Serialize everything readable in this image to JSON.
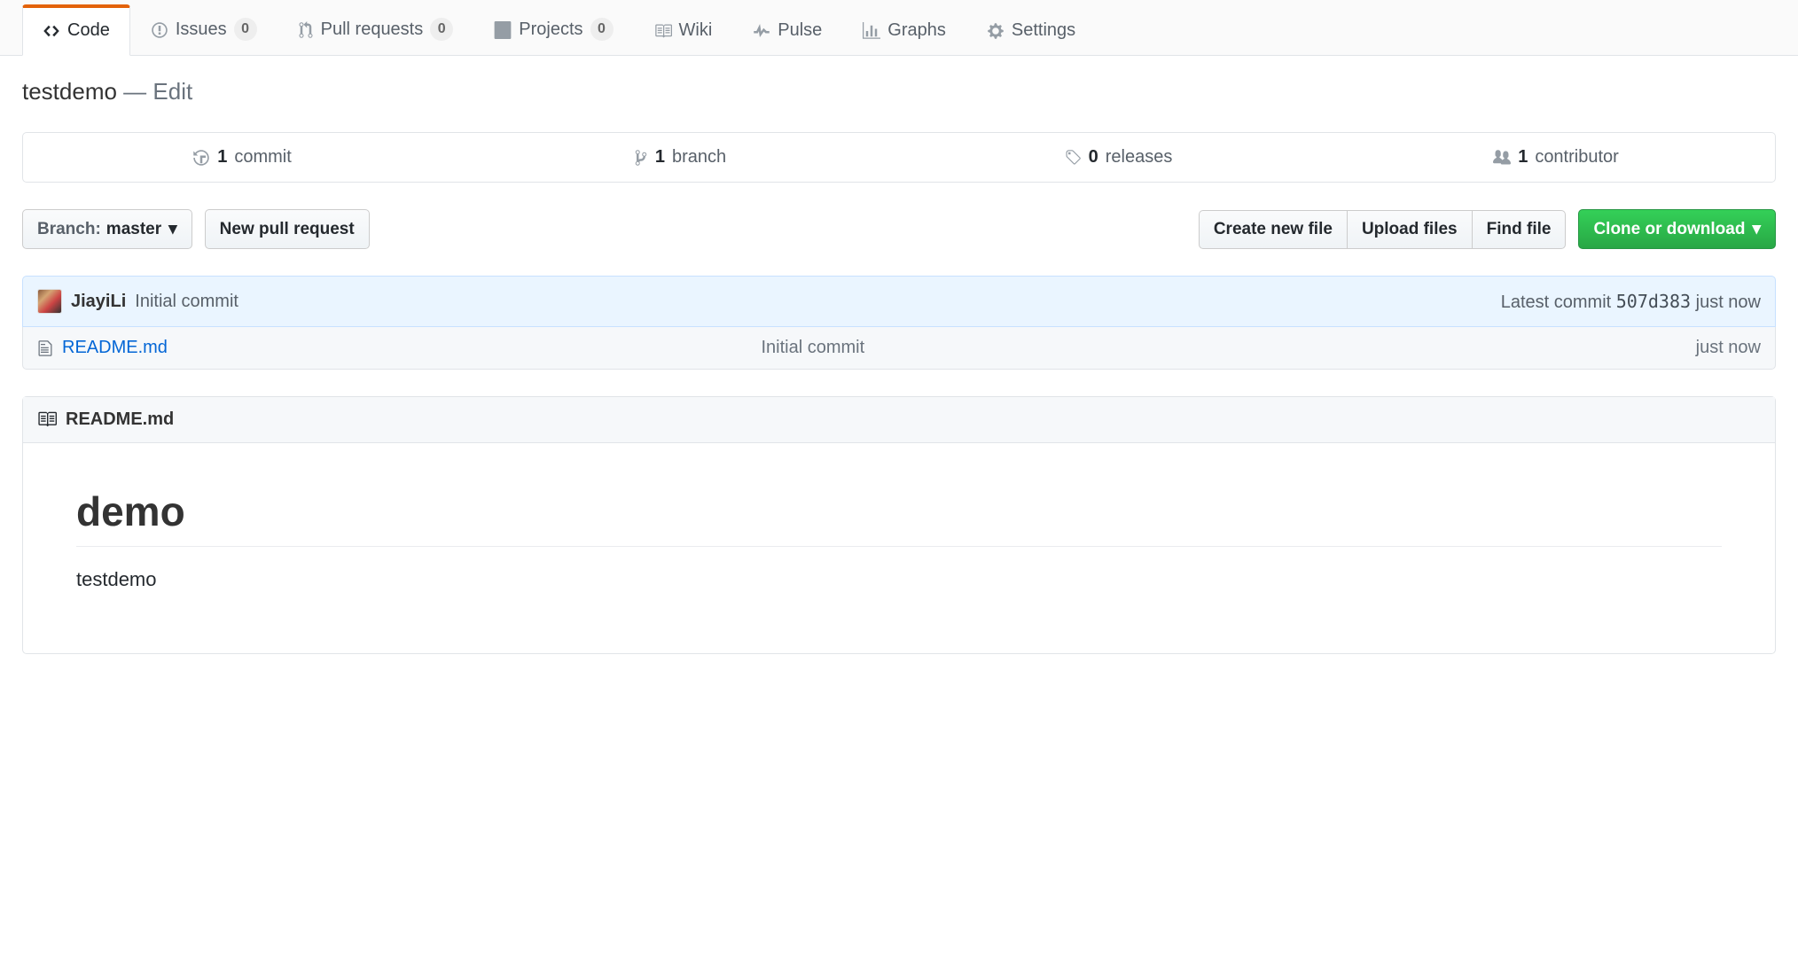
{
  "tabs": [
    {
      "label": "Code",
      "count": null
    },
    {
      "label": "Issues",
      "count": "0"
    },
    {
      "label": "Pull requests",
      "count": "0"
    },
    {
      "label": "Projects",
      "count": "0"
    },
    {
      "label": "Wiki",
      "count": null
    },
    {
      "label": "Pulse",
      "count": null
    },
    {
      "label": "Graphs",
      "count": null
    },
    {
      "label": "Settings",
      "count": null
    }
  ],
  "repo": {
    "description": "testdemo",
    "edit_label": "Edit",
    "separator": " — "
  },
  "stats": {
    "commits": {
      "count": "1",
      "label": "commit"
    },
    "branches": {
      "count": "1",
      "label": "branch"
    },
    "releases": {
      "count": "0",
      "label": "releases"
    },
    "contributors": {
      "count": "1",
      "label": "contributor"
    }
  },
  "branch_btn": {
    "prefix": "Branch:",
    "value": "master"
  },
  "buttons": {
    "new_pr": "New pull request",
    "create_file": "Create new file",
    "upload": "Upload files",
    "find": "Find file",
    "clone": "Clone or download"
  },
  "latest_commit": {
    "author": "JiayiLi",
    "message": "Initial commit",
    "prefix": "Latest commit",
    "sha": "507d383",
    "time": "just now"
  },
  "files": [
    {
      "name": "README.md",
      "commit_msg": "Initial commit",
      "time": "just now"
    }
  ],
  "readme": {
    "filename": "README.md",
    "heading": "demo",
    "body": "testdemo"
  }
}
